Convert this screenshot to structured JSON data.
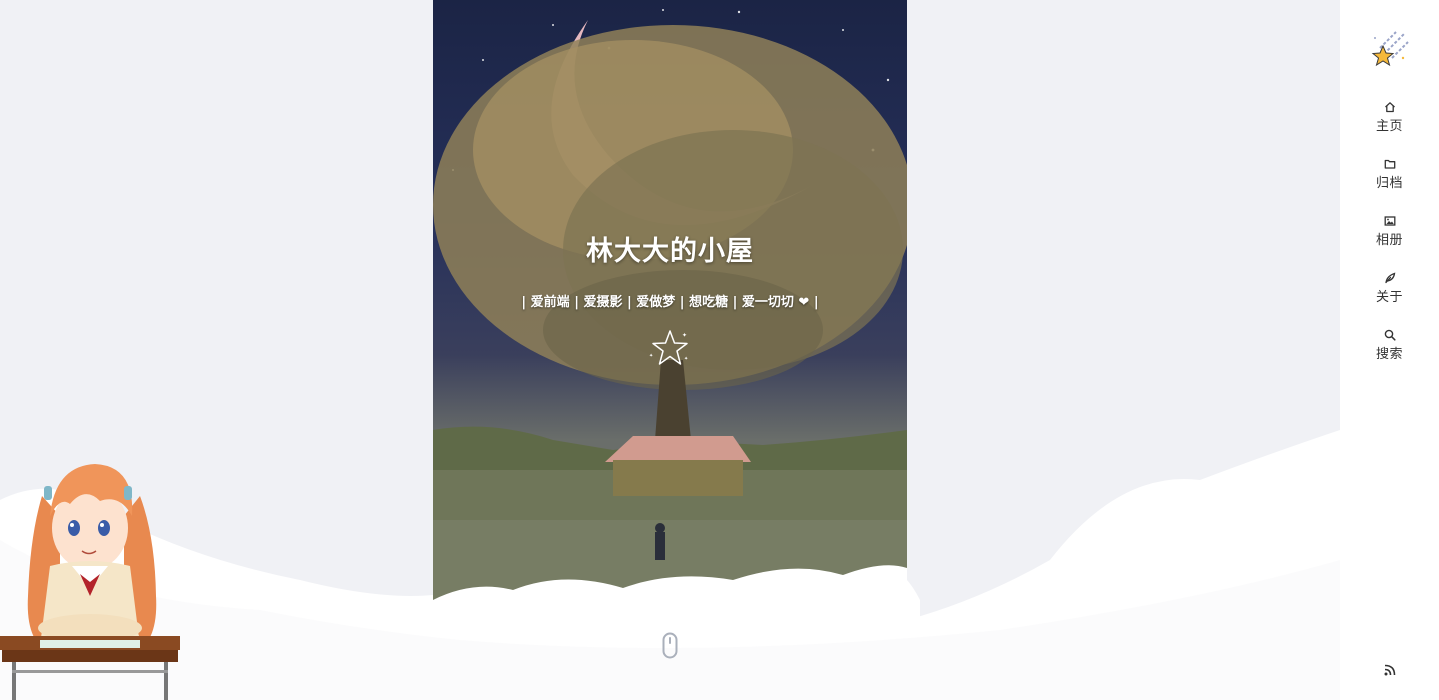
{
  "hero": {
    "title": "林大大的小屋",
    "subtitle": "| 爱前端 | 爱摄影 | 爱做梦 | 想吃糖 | 爱一切切 ❤ |"
  },
  "sidebar": {
    "items": [
      {
        "label": "主页",
        "icon": "home-icon"
      },
      {
        "label": "归档",
        "icon": "folder-icon"
      },
      {
        "label": "相册",
        "icon": "image-icon"
      },
      {
        "label": "关于",
        "icon": "feather-icon"
      },
      {
        "label": "搜索",
        "icon": "search-icon"
      }
    ],
    "footer_icon": "rss-icon"
  },
  "colors": {
    "page_bg": "#f0f1f5",
    "sidebar_bg": "#ffffff",
    "text": "#333333",
    "moon": "#f0c0c6",
    "star_gold": "#f6b93b"
  }
}
